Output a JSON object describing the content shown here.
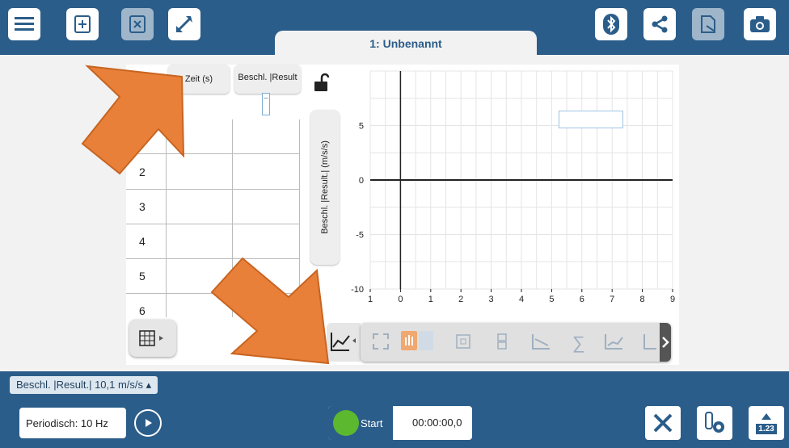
{
  "toolbar": {
    "icons": [
      "menu-icon",
      "new-file-icon",
      "delete-file-icon",
      "expand-icon",
      "bluetooth-icon",
      "share-icon",
      "export-icon",
      "camera-icon"
    ]
  },
  "tab": {
    "label": "1: Unbenannt"
  },
  "table": {
    "col1_header": "Zeit (s)",
    "col2_header": "Beschl. |Result",
    "col2_sub": "–",
    "rows": [
      "2",
      "3",
      "4",
      "5",
      "6"
    ]
  },
  "chart_data": {
    "type": "line",
    "ylabel": "Beschl. |Result.| (m/s/s)",
    "xlabel": "",
    "xlim": [
      -1,
      9
    ],
    "ylim": [
      -10,
      10
    ],
    "x_ticks": [
      "1",
      "0",
      "1",
      "2",
      "3",
      "4",
      "5",
      "6",
      "7",
      "8",
      "9"
    ],
    "y_ticks": [
      "5",
      "0",
      "-5",
      "-10"
    ],
    "series": []
  },
  "sensor": {
    "label": "Beschl. |Result.|  10,1  m/s/s ▴"
  },
  "period": {
    "label": "Periodisch: 10 Hz"
  },
  "start": {
    "label": "Start",
    "timer": "00:00:00,0"
  },
  "bottom_buttons": {
    "readout_label": "1.23"
  },
  "colors": {
    "primary": "#2b5d8a",
    "start_green": "#5cb82e",
    "arrow": "#e8803a"
  }
}
